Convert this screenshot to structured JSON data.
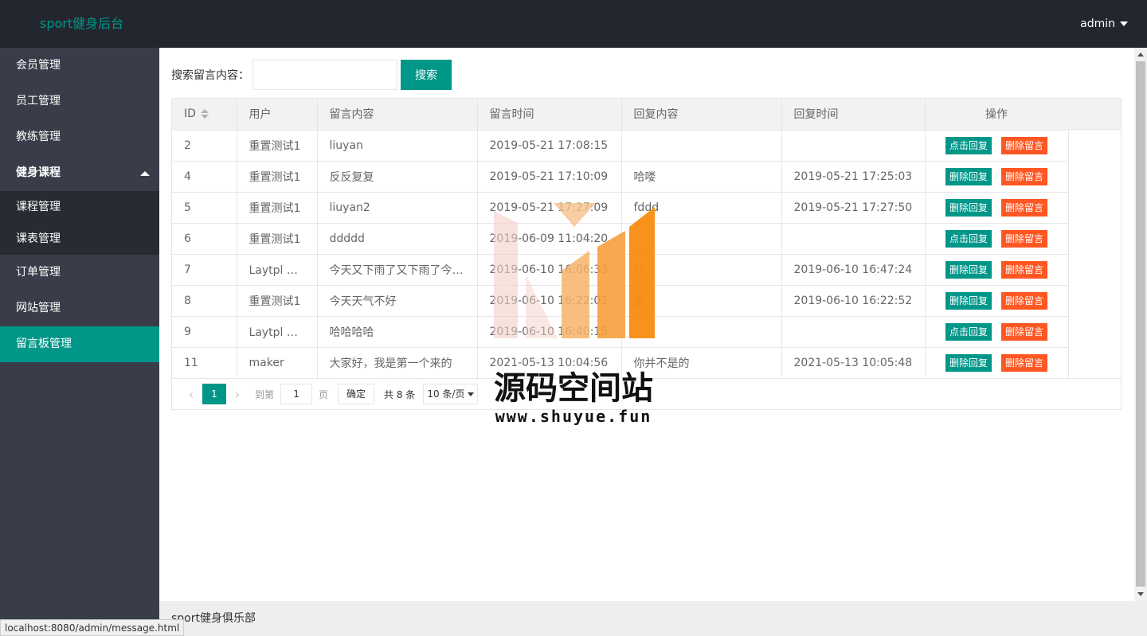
{
  "header": {
    "brand": "sport健身后台",
    "user": "admin"
  },
  "sidebar": {
    "items": [
      {
        "label": "会员管理"
      },
      {
        "label": "员工管理"
      },
      {
        "label": "教练管理"
      },
      {
        "label": "健身课程"
      },
      {
        "label": "订单管理"
      },
      {
        "label": "网站管理"
      },
      {
        "label": "留言板管理"
      }
    ],
    "subitems": [
      {
        "label": "课程管理"
      },
      {
        "label": "课表管理"
      }
    ]
  },
  "search": {
    "label": "搜索留言内容：",
    "value": "",
    "button": "搜索"
  },
  "table": {
    "headers": [
      "ID",
      "用户",
      "留言内容",
      "留言时间",
      "回复内容",
      "回复时间",
      "操作"
    ],
    "rows": [
      {
        "id": "2",
        "user": "重置测试1",
        "content": "liuyan",
        "time": "2019-05-21 17:08:15",
        "reply": "",
        "reply_time": "",
        "action1": "点击回复",
        "action2": "删除留言"
      },
      {
        "id": "4",
        "user": "重置测试1",
        "content": "反反复复",
        "time": "2019-05-21 17:10:09",
        "reply": "哈喽",
        "reply_time": "2019-05-21 17:25:03",
        "action1": "删除回复",
        "action2": "删除留言"
      },
      {
        "id": "5",
        "user": "重置测试1",
        "content": "liuyan2",
        "time": "2019-05-21 17:27:09",
        "reply": "fddd",
        "reply_time": "2019-05-21 17:27:50",
        "action1": "删除回复",
        "action2": "删除留言"
      },
      {
        "id": "6",
        "user": "重置测试1",
        "content": "ddddd",
        "time": "2019-06-09 11:04:20",
        "reply": "",
        "reply_time": "",
        "action1": "点击回复",
        "action2": "删除留言"
      },
      {
        "id": "7",
        "user": "Laytpl Error：SyntaxError",
        "content": "今天又下雨了又下雨了今天又下雨了",
        "time": "2019-06-10 16:06:33",
        "reply": "好",
        "reply_time": "2019-06-10 16:47:24",
        "action1": "删除回复",
        "action2": "删除留言"
      },
      {
        "id": "8",
        "user": "重置测试1",
        "content": "今天天气不好",
        "time": "2019-06-10 16:22:01",
        "reply": "是",
        "reply_time": "2019-06-10 16:22:52",
        "action1": "删除回复",
        "action2": "删除留言"
      },
      {
        "id": "9",
        "user": "Laytpl Error：SyntaxError",
        "content": "哈哈哈哈",
        "time": "2019-06-10 16:40:15",
        "reply": "",
        "reply_time": "",
        "action1": "点击回复",
        "action2": "删除留言"
      },
      {
        "id": "11",
        "user": "maker",
        "content": "大家好，我是第一个来的",
        "time": "2021-05-13 10:04:56",
        "reply": "你并不是的",
        "reply_time": "2021-05-13 10:05:48",
        "action1": "删除回复",
        "action2": "删除留言"
      }
    ]
  },
  "pager": {
    "prev": "‹",
    "current": "1",
    "next": "›",
    "goto_label": "到第",
    "goto_value": "1",
    "page_label": "页",
    "confirm": "确定",
    "total": "共 8 条",
    "per_page": "10 条/页"
  },
  "footer": {
    "text": "sport健身俱乐部"
  },
  "status_bar": {
    "url": "localhost:8080/admin/message.html"
  },
  "watermark": {
    "title": "源码空间站",
    "url": "www.shuyue.fun"
  }
}
